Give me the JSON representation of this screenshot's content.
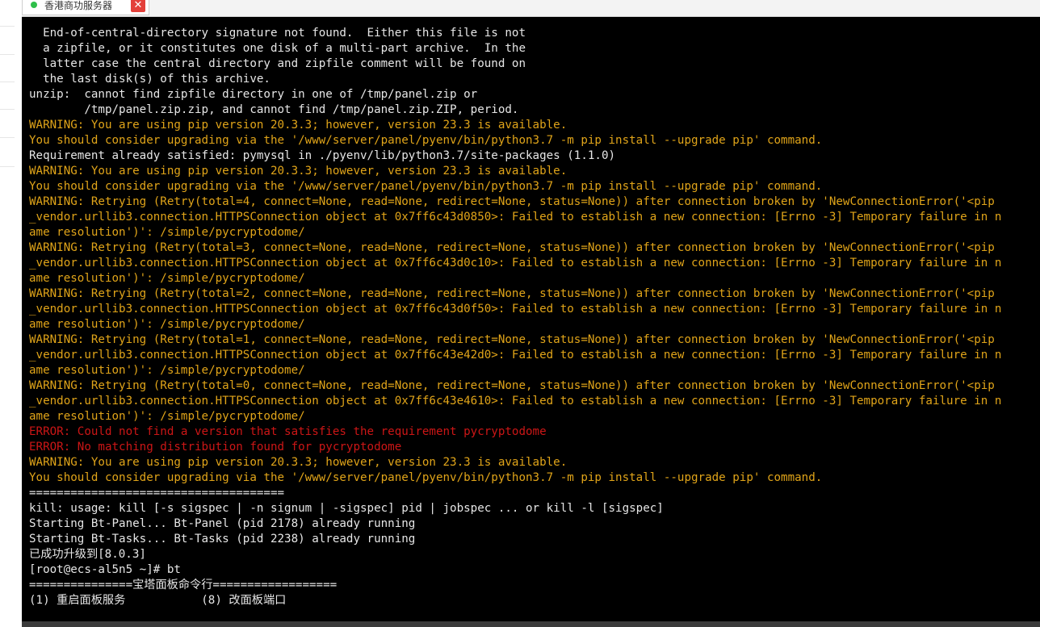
{
  "colors": {
    "terminal_bg": "#000000",
    "text_default": "#e6e6e6",
    "text_warning": "#e0a419",
    "text_error": "#cc1616",
    "tab_status_dot": "#2fbf4a",
    "tab_close_bg": "#e3403a"
  },
  "tab": {
    "title": "香港商功服务器",
    "close_label": "✕"
  },
  "terminal": {
    "lines": [
      {
        "text": "  End-of-central-directory signature not found.  Either this file is not",
        "kind": "normal"
      },
      {
        "text": "  a zipfile, or it constitutes one disk of a multi-part archive.  In the",
        "kind": "normal"
      },
      {
        "text": "  latter case the central directory and zipfile comment will be found on",
        "kind": "normal"
      },
      {
        "text": "  the last disk(s) of this archive.",
        "kind": "normal"
      },
      {
        "text": "unzip:  cannot find zipfile directory in one of /tmp/panel.zip or",
        "kind": "normal"
      },
      {
        "text": "        /tmp/panel.zip.zip, and cannot find /tmp/panel.zip.ZIP, period.",
        "kind": "normal"
      },
      {
        "text": "WARNING: You are using pip version 20.3.3; however, version 23.3 is available.",
        "kind": "warning"
      },
      {
        "text": "You should consider upgrading via the '/www/server/panel/pyenv/bin/python3.7 -m pip install --upgrade pip' command.",
        "kind": "warning"
      },
      {
        "text": "Requirement already satisfied: pymysql in ./pyenv/lib/python3.7/site-packages (1.1.0)",
        "kind": "normal"
      },
      {
        "text": "WARNING: You are using pip version 20.3.3; however, version 23.3 is available.",
        "kind": "warning"
      },
      {
        "text": "You should consider upgrading via the '/www/server/panel/pyenv/bin/python3.7 -m pip install --upgrade pip' command.",
        "kind": "warning"
      },
      {
        "text": "WARNING: Retrying (Retry(total=4, connect=None, read=None, redirect=None, status=None)) after connection broken by 'NewConnectionError('<pip",
        "kind": "warning"
      },
      {
        "text": "_vendor.urllib3.connection.HTTPSConnection object at 0x7ff6c43d0850>: Failed to establish a new connection: [Errno -3] Temporary failure in n",
        "kind": "warning"
      },
      {
        "text": "ame resolution')': /simple/pycryptodome/",
        "kind": "warning"
      },
      {
        "text": "WARNING: Retrying (Retry(total=3, connect=None, read=None, redirect=None, status=None)) after connection broken by 'NewConnectionError('<pip",
        "kind": "warning"
      },
      {
        "text": "_vendor.urllib3.connection.HTTPSConnection object at 0x7ff6c43d0c10>: Failed to establish a new connection: [Errno -3] Temporary failure in n",
        "kind": "warning"
      },
      {
        "text": "ame resolution')': /simple/pycryptodome/",
        "kind": "warning"
      },
      {
        "text": "WARNING: Retrying (Retry(total=2, connect=None, read=None, redirect=None, status=None)) after connection broken by 'NewConnectionError('<pip",
        "kind": "warning"
      },
      {
        "text": "_vendor.urllib3.connection.HTTPSConnection object at 0x7ff6c43d0f50>: Failed to establish a new connection: [Errno -3] Temporary failure in n",
        "kind": "warning"
      },
      {
        "text": "ame resolution')': /simple/pycryptodome/",
        "kind": "warning"
      },
      {
        "text": "WARNING: Retrying (Retry(total=1, connect=None, read=None, redirect=None, status=None)) after connection broken by 'NewConnectionError('<pip",
        "kind": "warning"
      },
      {
        "text": "_vendor.urllib3.connection.HTTPSConnection object at 0x7ff6c43e42d0>: Failed to establish a new connection: [Errno -3] Temporary failure in n",
        "kind": "warning"
      },
      {
        "text": "ame resolution')': /simple/pycryptodome/",
        "kind": "warning"
      },
      {
        "text": "WARNING: Retrying (Retry(total=0, connect=None, read=None, redirect=None, status=None)) after connection broken by 'NewConnectionError('<pip",
        "kind": "warning"
      },
      {
        "text": "_vendor.urllib3.connection.HTTPSConnection object at 0x7ff6c43e4610>: Failed to establish a new connection: [Errno -3] Temporary failure in n",
        "kind": "warning"
      },
      {
        "text": "ame resolution')': /simple/pycryptodome/",
        "kind": "warning"
      },
      {
        "text": "ERROR: Could not find a version that satisfies the requirement pycryptodome",
        "kind": "error"
      },
      {
        "text": "ERROR: No matching distribution found for pycryptodome",
        "kind": "error"
      },
      {
        "text": "WARNING: You are using pip version 20.3.3; however, version 23.3 is available.",
        "kind": "warning"
      },
      {
        "text": "You should consider upgrading via the '/www/server/panel/pyenv/bin/python3.7 -m pip install --upgrade pip' command.",
        "kind": "warning"
      },
      {
        "text": "=====================================",
        "kind": "normal"
      },
      {
        "text": "kill: usage: kill [-s sigspec | -n signum | -sigspec] pid | jobspec ... or kill -l [sigspec]",
        "kind": "normal"
      },
      {
        "text": "Starting Bt-Panel... Bt-Panel (pid 2178) already running",
        "kind": "normal"
      },
      {
        "text": "Starting Bt-Tasks... Bt-Tasks (pid 2238) already running",
        "kind": "normal"
      },
      {
        "text": "已成功升级到[8.0.3]",
        "kind": "normal"
      },
      {
        "text": "[root@ecs-al5n5 ~]# bt",
        "kind": "normal"
      },
      {
        "text": "===============宝塔面板命令行==================",
        "kind": "normal"
      },
      {
        "text": "(1) 重启面板服务           (8) 改面板端口",
        "kind": "normal"
      }
    ]
  }
}
